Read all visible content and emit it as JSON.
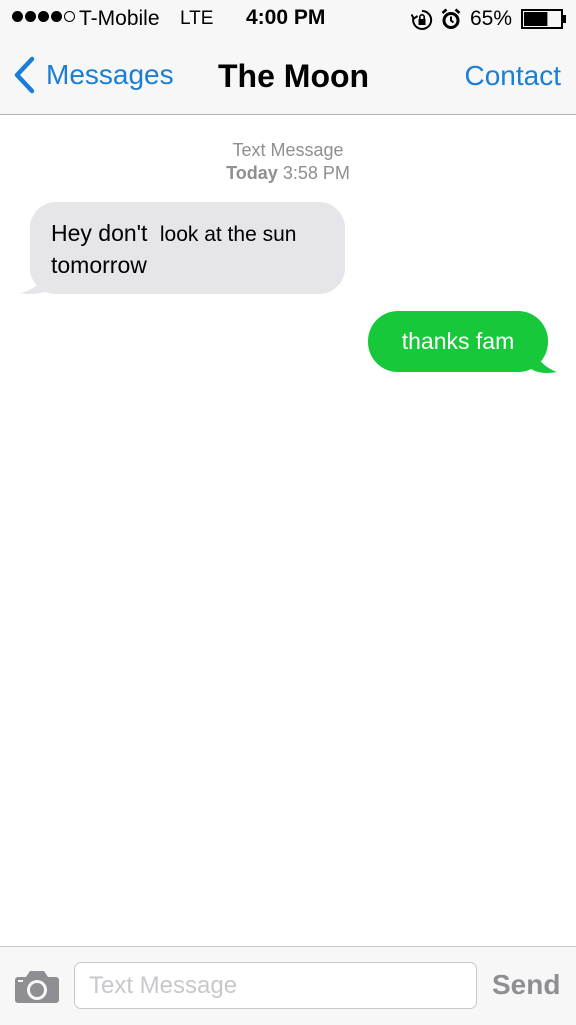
{
  "status_bar": {
    "signal_bars_filled": 4,
    "signal_bars_total": 5,
    "carrier": "T-Mobile",
    "network": "LTE",
    "time": "4:00 PM",
    "battery_percent": "65%",
    "battery_level": 0.65,
    "icons": [
      "rotation-lock-icon",
      "alarm-icon",
      "battery-icon"
    ]
  },
  "nav": {
    "back_label": "Messages",
    "title": "The Moon",
    "contact_label": "Contact",
    "accent_color": "#1a7ed6"
  },
  "thread": {
    "header_label": "Text Message",
    "day": "Today",
    "time": "3:58 PM",
    "messages": [
      {
        "direction": "incoming",
        "line1_part1": "Hey don't",
        "line1_part2": "look at the sun",
        "line2": "tomorrow",
        "bubble_color": "#e5e5ea"
      },
      {
        "direction": "outgoing",
        "text": "thanks fam",
        "bubble_color": "#17c93a"
      }
    ]
  },
  "input_bar": {
    "camera_icon": "camera-icon",
    "placeholder": "Text Message",
    "value": "",
    "send_label": "Send"
  }
}
